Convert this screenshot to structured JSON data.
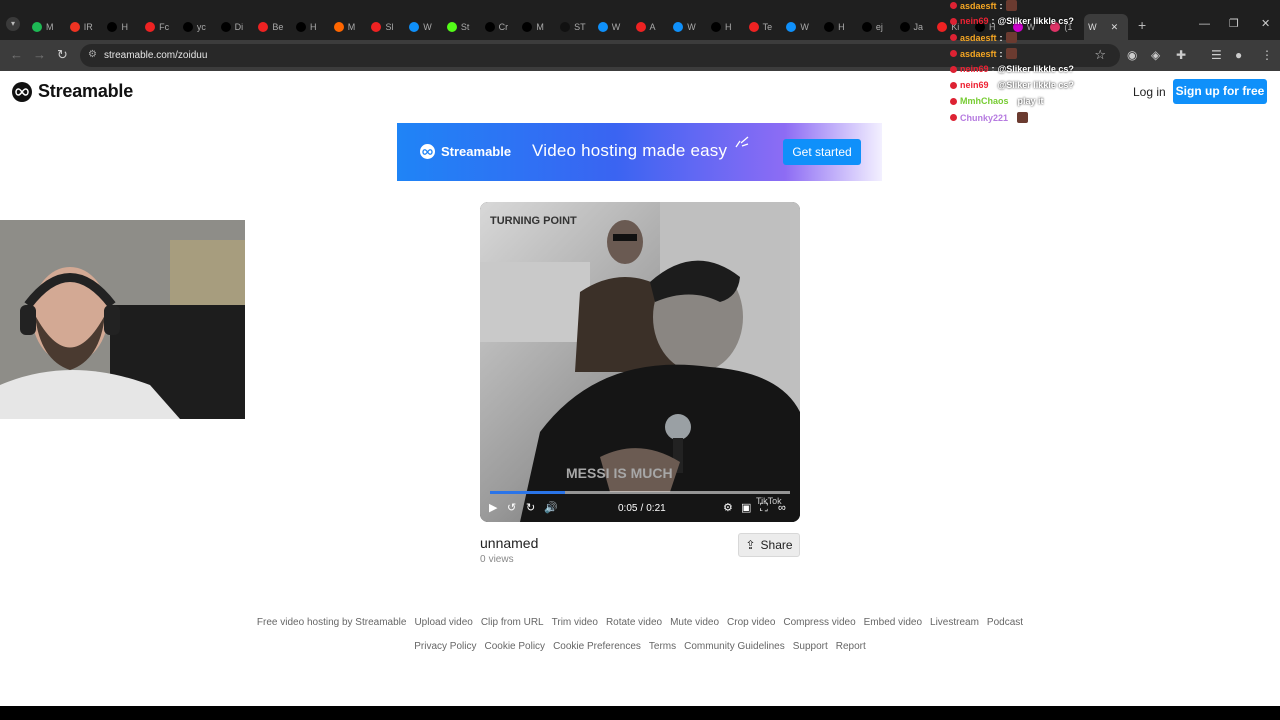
{
  "browser": {
    "tabs": [
      {
        "label": "M",
        "color": "#1db954"
      },
      {
        "label": "IR",
        "color": "#e32"
      },
      {
        "label": "H",
        "color": "#000"
      },
      {
        "label": "Fc",
        "color": "#e22"
      },
      {
        "label": "yc",
        "color": "#000"
      },
      {
        "label": "Di",
        "color": "#000"
      },
      {
        "label": "Be",
        "color": "#e22"
      },
      {
        "label": "H",
        "color": "#000"
      },
      {
        "label": "M",
        "color": "#f60"
      },
      {
        "label": "Sl",
        "color": "#e22"
      },
      {
        "label": "W",
        "color": "#0f90fa"
      },
      {
        "label": "St",
        "color": "#53fc18"
      },
      {
        "label": "Cr",
        "color": "#000"
      },
      {
        "label": "M",
        "color": "#000"
      },
      {
        "label": "ST",
        "color": "#111"
      },
      {
        "label": "W",
        "color": "#0f90fa"
      },
      {
        "label": "A",
        "color": "#e22"
      },
      {
        "label": "W",
        "color": "#0f90fa"
      },
      {
        "label": "H",
        "color": "#000"
      },
      {
        "label": "Te",
        "color": "#e22"
      },
      {
        "label": "W",
        "color": "#0f90fa"
      },
      {
        "label": "H",
        "color": "#000"
      },
      {
        "label": "ej",
        "color": "#000"
      },
      {
        "label": "Ja",
        "color": "#000"
      },
      {
        "label": "Ki",
        "color": "#e22"
      },
      {
        "label": "H",
        "color": "#000"
      },
      {
        "label": "W",
        "color": "#c0c"
      },
      {
        "label": "(1",
        "color": "#d36"
      }
    ],
    "active_tab": {
      "label": "W"
    },
    "url": "streamable.com/zoiduu"
  },
  "header": {
    "brand": "Streamable",
    "login": "Log in",
    "signup": "Sign up for free"
  },
  "banner": {
    "brand": "Streamable",
    "tagline": "Video hosting made easy",
    "cta": "Get started"
  },
  "video": {
    "current_time": "0:05",
    "separator": "/",
    "duration": "0:21",
    "progress": 0.25,
    "buffered": 0.24,
    "overlay_text": "TURNING POINT",
    "caption_text": "MESSI IS MUCH",
    "watermark": "TikTok",
    "title": "unnamed",
    "views_count": "0",
    "views_label": "views",
    "share_label": "Share"
  },
  "footer": {
    "row1": [
      "Free video hosting by Streamable",
      "Upload video",
      "Clip from URL",
      "Trim video",
      "Rotate video",
      "Mute video",
      "Crop video",
      "Compress video",
      "Embed video",
      "Livestream",
      "Podcast"
    ],
    "row2": [
      "Privacy Policy",
      "Cookie Policy",
      "Cookie Preferences",
      "Terms",
      "Community Guidelines",
      "Support",
      "Report"
    ]
  },
  "chat": [
    {
      "user": "asdaesft",
      "color": "#f5a623",
      "msg": "",
      "emote": true
    },
    {
      "user": "nein69",
      "color": "#e23",
      "msg": "@Sliker likkle cs?",
      "emote": false
    },
    {
      "user": "asdaesft",
      "color": "#f5a623",
      "msg": "",
      "emote": true
    },
    {
      "user": "asdaesft",
      "color": "#f5a623",
      "msg": "",
      "emote": true
    },
    {
      "user": "nein69",
      "color": "#e23",
      "msg": "@Sliker likkle cs?",
      "emote": false
    },
    {
      "user": "nein69",
      "color": "#e23",
      "msg": "@Sliker likkle cs?",
      "emote": false
    },
    {
      "user": "MmhChaos",
      "color": "#7c3",
      "msg": "play it",
      "emote": false
    },
    {
      "user": "Chunky221",
      "color": "#b67be0",
      "msg": "",
      "emote": true
    }
  ]
}
